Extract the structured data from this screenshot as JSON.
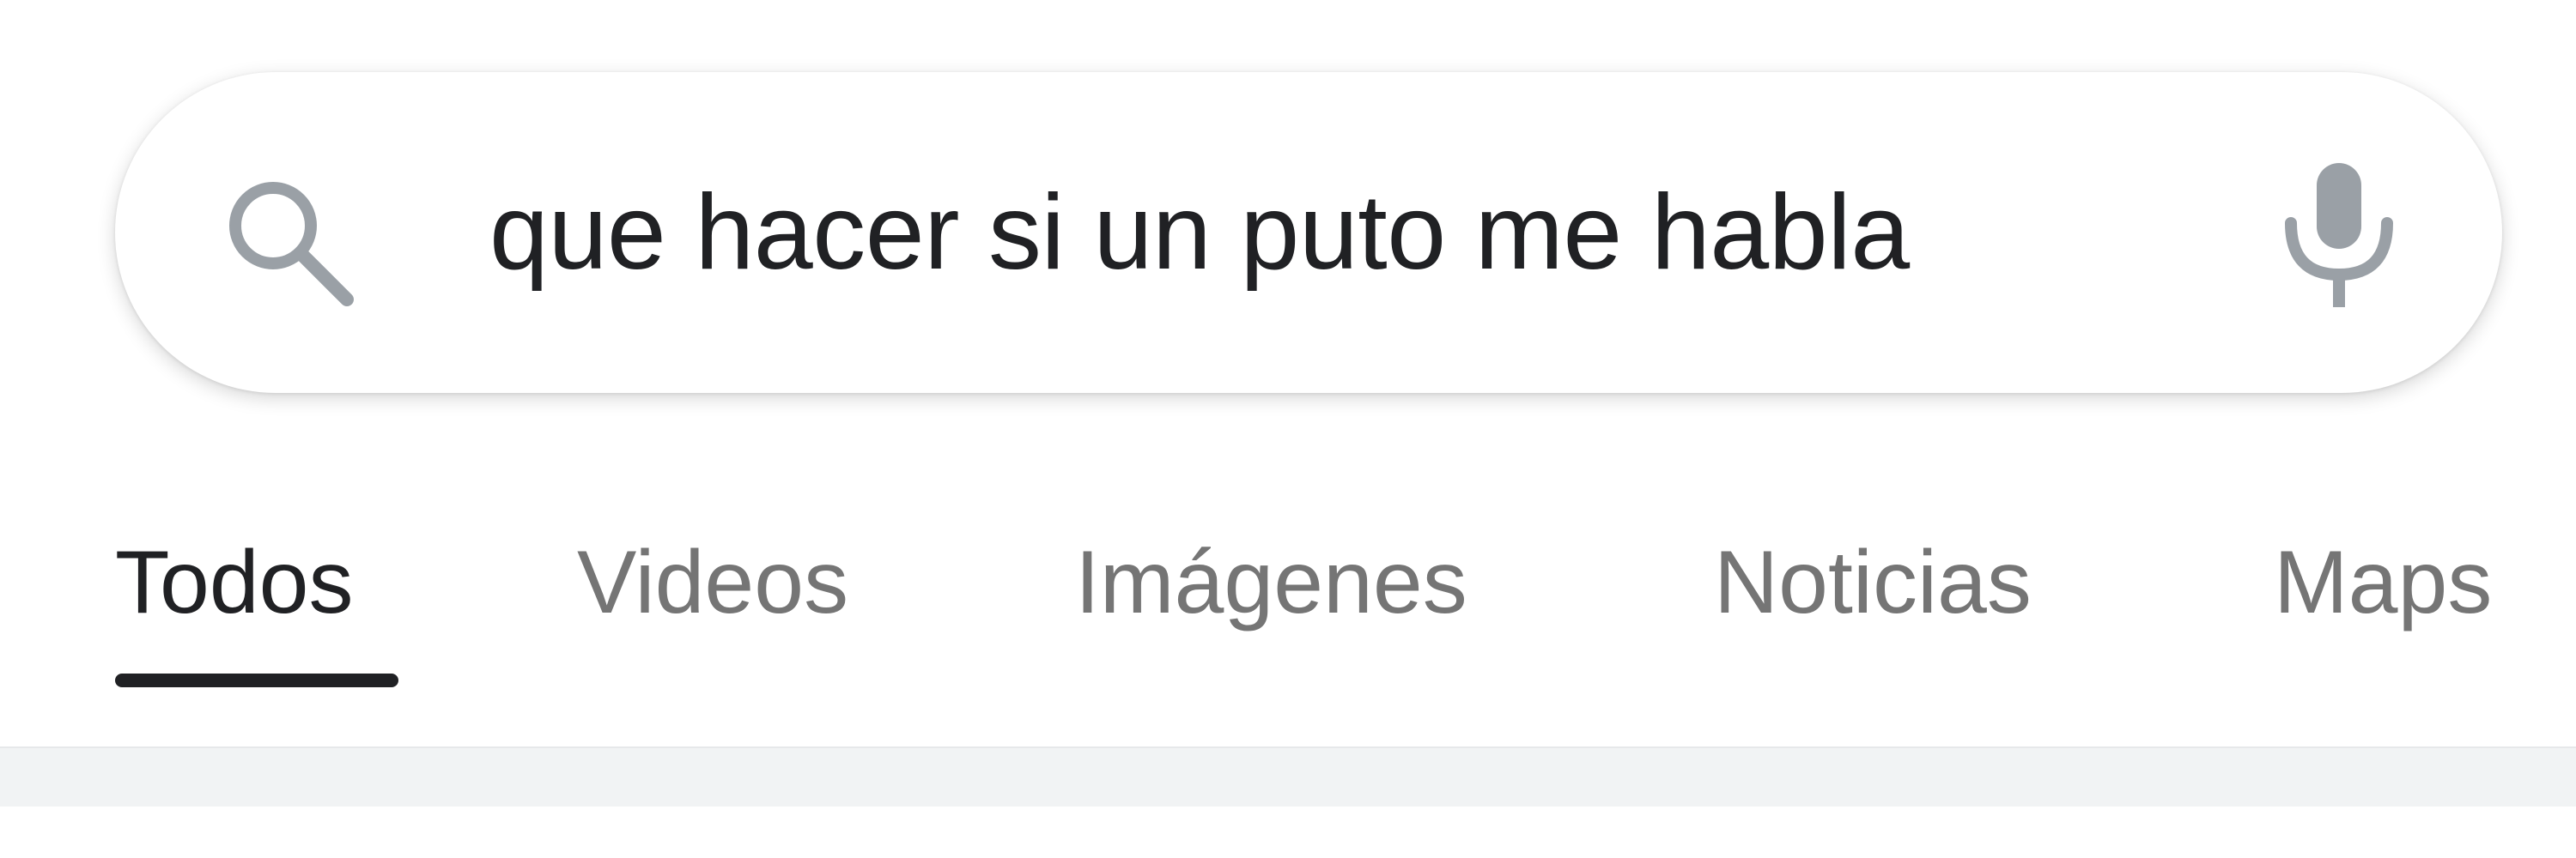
{
  "search": {
    "query": "que hacer si un puto me habla",
    "search_icon": "search-icon",
    "mic_icon": "microphone-icon"
  },
  "tabs": [
    {
      "label": "Todos",
      "active": true
    },
    {
      "label": "Videos",
      "active": false
    },
    {
      "label": "Imágenes",
      "active": false
    },
    {
      "label": "Noticias",
      "active": false
    },
    {
      "label": "Maps",
      "active": false
    }
  ],
  "colors": {
    "text_primary": "#202124",
    "text_secondary": "#757575",
    "icon_gray": "#9aa0a6",
    "divider": "#f1f3f4"
  }
}
